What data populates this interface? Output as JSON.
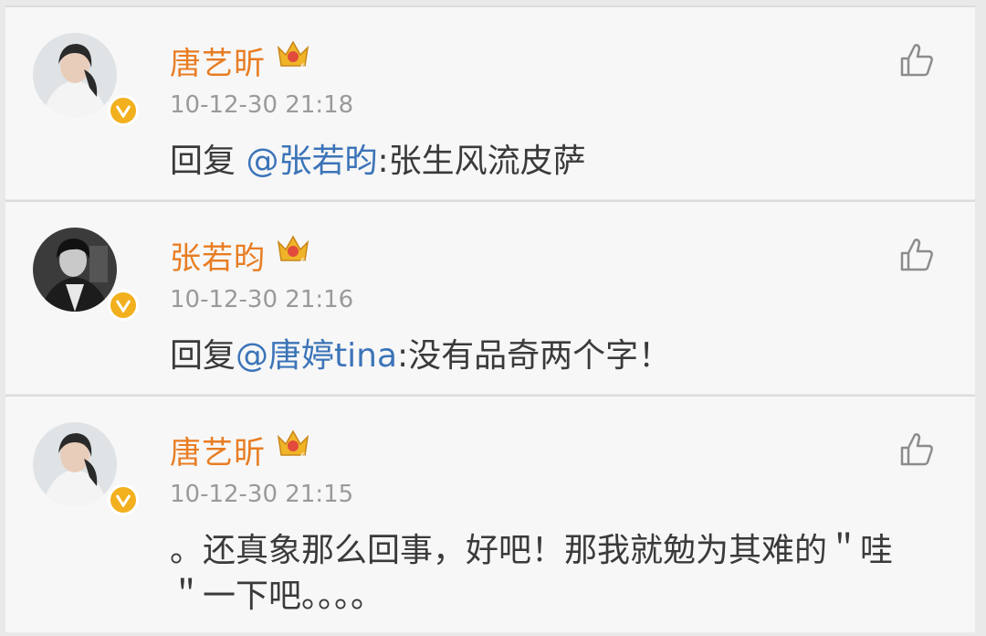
{
  "comments": [
    {
      "user": "唐艺昕",
      "time": "10-12-30 21:18",
      "reply_prefix": "回复 ",
      "mention": "@张若昀",
      "text": ":张生风流皮萨"
    },
    {
      "user": "张若昀",
      "time": "10-12-30 21:16",
      "reply_prefix": "回复",
      "mention": "@唐婷tina",
      "text": ":没有品奇两个字！"
    },
    {
      "user": "唐艺昕",
      "time": "10-12-30 21:15",
      "text": "。还真象那么回事，好吧！那我就勉为其难的＂哇＂一下吧。。。。"
    }
  ],
  "colors": {
    "username": "#e87d23",
    "mention": "#3c74b8",
    "verified_badge": "#f2b01e",
    "crown": "#f0b429"
  },
  "icons": [
    "verified-icon",
    "crown-level-icon",
    "thumbs-up-icon"
  ]
}
